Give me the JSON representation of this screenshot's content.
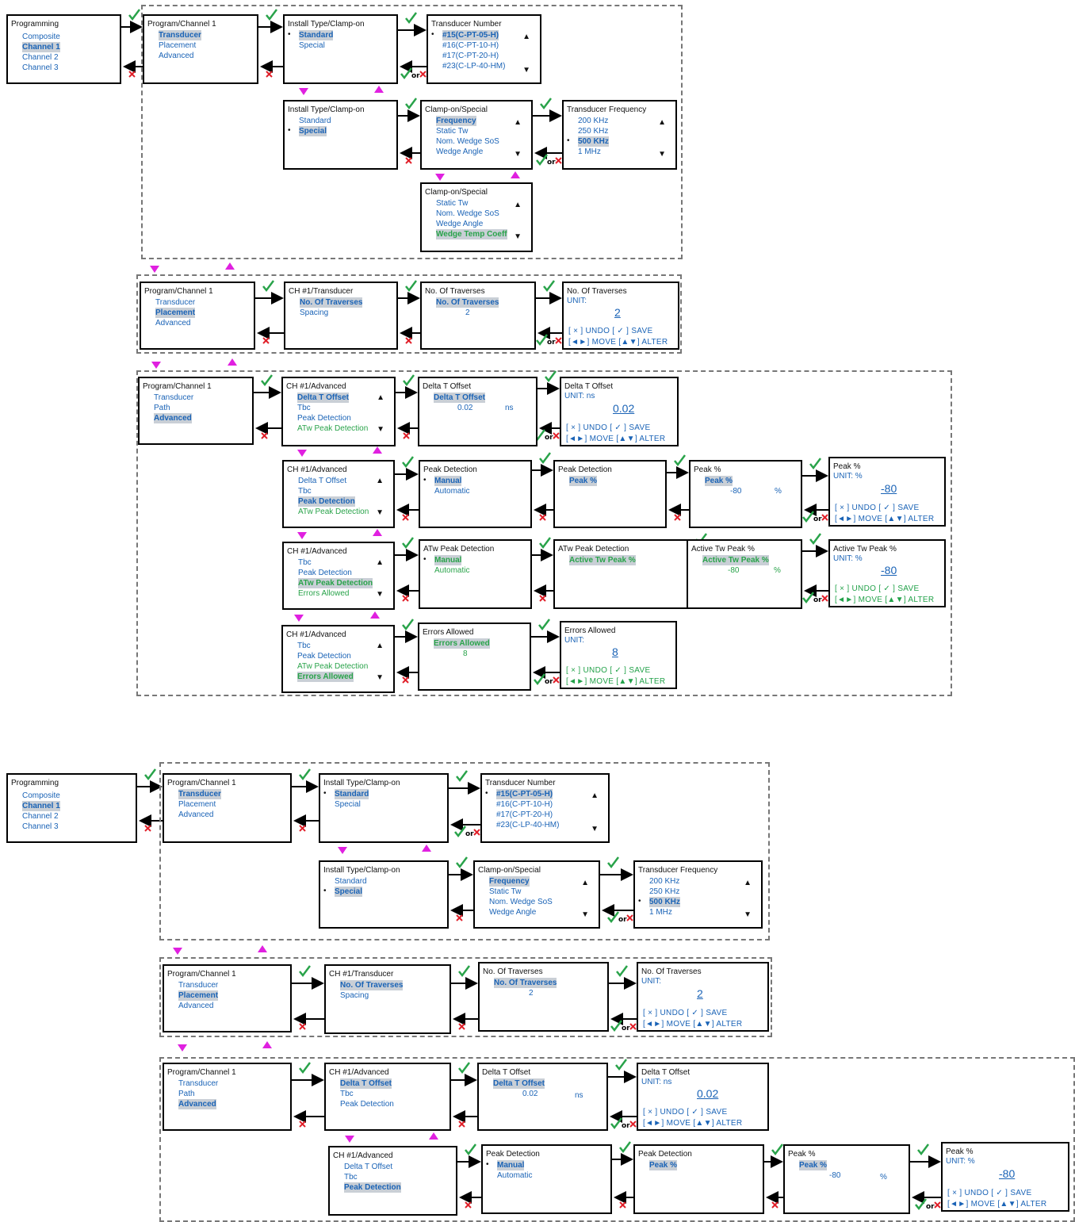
{
  "labels": {
    "programming": "Programming",
    "composite": "Composite",
    "channel1": "Channel 1",
    "channel2": "Channel 2",
    "channel3": "Channel 3",
    "prog_ch1": "Program/Channel 1",
    "transducer": "Transducer",
    "placement": "Placement",
    "advanced": "Advanced",
    "path": "Path",
    "install_type": "Install Type/Clamp-on",
    "standard": "Standard",
    "special": "Special",
    "transducer_number": "Transducer Number",
    "tn15": "#15(C-PT-05-H)",
    "tn16": "#16(C-PT-10-H)",
    "tn17": "#17(C-PT-20-H)",
    "tn23": "#23(C-LP-40-HM)",
    "clamp_special": "Clamp-on/Special",
    "frequency": "Frequency",
    "static_tw": "Static Tw",
    "nom_wedge": "Nom. Wedge SoS",
    "wedge_angle": "Wedge Angle",
    "wedge_temp": "Wedge Temp Coeff",
    "transducer_frequency": "Transducer Frequency",
    "f200": "200 KHz",
    "f250": "250 KHz",
    "f500": "500 KHz",
    "f1m": "1 MHz",
    "ch1_transducer": "CH #1/Transducer",
    "no_traverses": "No. Of Traverses",
    "spacing": "Spacing",
    "traverses_value": "2",
    "unit_label": "UNIT:",
    "ch1_advanced": "CH #1/Advanced",
    "delta_t": "Delta T Offset",
    "tbc": "Tbc",
    "peak_detection": "Peak Detection",
    "atw_peak": "ATw Peak Detection",
    "errors_allowed": "Errors Allowed",
    "delta_value": "0.02",
    "ns": "ns",
    "unit_ns": "UNIT:   ns",
    "manual": "Manual",
    "automatic": "Automatic",
    "peak_pct": "Peak %",
    "peak_value": "-80",
    "pct": "%",
    "unit_pct": "UNIT:   %",
    "active_tw_peak": "Active Tw Peak %",
    "errors_value": "8",
    "ctl_row1": "[ × ]   UNDO   [ ✓ ]   SAVE",
    "ctl_row2": "[◄►]   MOVE   [▲▼]   ALTER",
    "or": "or"
  },
  "colors": {
    "accent_blue": "#1a63b6",
    "accent_green": "#29a34a",
    "cross_red": "#e0202a",
    "nav_magenta": "#e020e0",
    "highlight": "#c9cfd6"
  },
  "icons": [
    "checkmark-icon",
    "cross-icon",
    "arrow-right-icon",
    "arrow-left-icon",
    "triangle-up-icon",
    "triangle-down-icon"
  ]
}
